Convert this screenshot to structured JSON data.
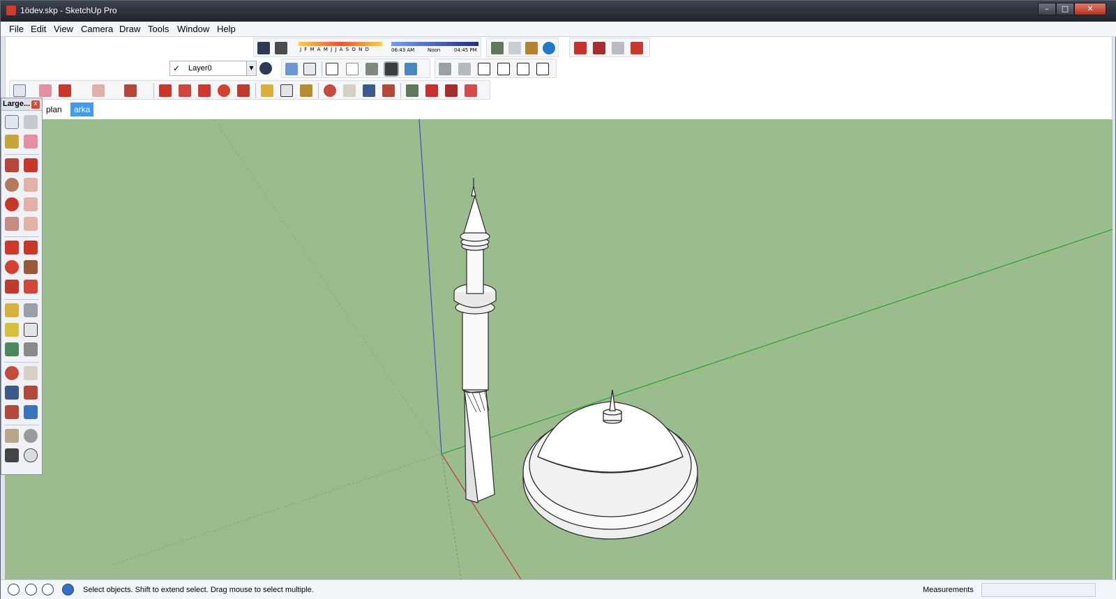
{
  "window": {
    "title": "1ödev.skp - SketchUp Pro",
    "min": "–",
    "max": "□",
    "close": "✕"
  },
  "menu": {
    "items": [
      "File",
      "Edit",
      "View",
      "Camera",
      "Draw",
      "Tools",
      "Window",
      "Help"
    ]
  },
  "shadow": {
    "months": "J F M A M J J A S O N D",
    "time_start": "06:43 AM",
    "time_noon": "Noon",
    "time_end": "04:45 PM"
  },
  "layers": {
    "current": "Layer0",
    "check": "✓",
    "arrow": "▼"
  },
  "scenes": {
    "tabs": [
      "plan",
      "arka plan"
    ],
    "active": "arka plan"
  },
  "palette": {
    "title": "Large...",
    "close": "x"
  },
  "statusbar": {
    "message": "Select objects. Shift to extend select. Drag mouse to select multiple.",
    "measurements_label": "Measurements",
    "measurements_value": ""
  },
  "colors": {
    "viewport": "#9bbd8e",
    "axis_red": "#c0392b",
    "axis_green": "#27a22b",
    "axis_blue": "#2f4fd0",
    "active_tab": "#3f9af0"
  }
}
